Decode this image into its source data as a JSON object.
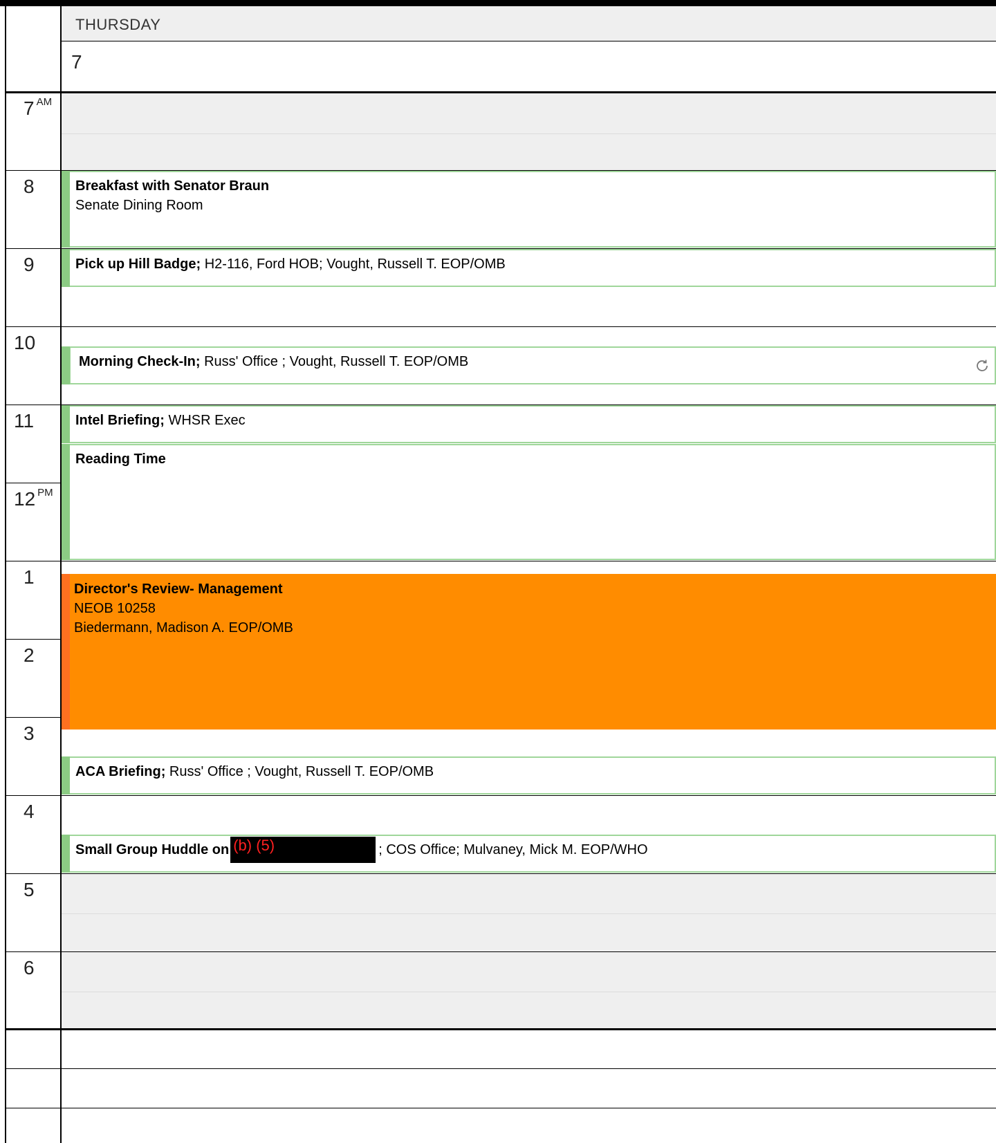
{
  "day": {
    "name": "THURSDAY",
    "number": "7"
  },
  "hours": [
    {
      "label": "7",
      "suffix": "AM"
    },
    {
      "label": "8",
      "suffix": ""
    },
    {
      "label": "9",
      "suffix": ""
    },
    {
      "label": "10",
      "suffix": ""
    },
    {
      "label": "11",
      "suffix": ""
    },
    {
      "label": "12",
      "suffix": "PM"
    },
    {
      "label": "1",
      "suffix": ""
    },
    {
      "label": "2",
      "suffix": ""
    },
    {
      "label": "3",
      "suffix": ""
    },
    {
      "label": "4",
      "suffix": ""
    },
    {
      "label": "5",
      "suffix": ""
    },
    {
      "label": "6",
      "suffix": ""
    }
  ],
  "events": {
    "breakfast": {
      "title": "Breakfast with Senator Braun",
      "location": "Senate Dining Room"
    },
    "badge": {
      "title": "Pick up Hill Badge;",
      "details": " H2-116, Ford HOB; Vought, Russell T. EOP/OMB"
    },
    "checkin": {
      "title": "Morning Check-In;",
      "details": " Russ' Office ; Vought, Russell T. EOP/OMB",
      "icon": "sync-icon"
    },
    "intel": {
      "title": "Intel Briefing;",
      "details": " WHSR Exec"
    },
    "reading": {
      "title": "Reading Time"
    },
    "review": {
      "title": "Director's Review- Management",
      "location": "NEOB 10258",
      "attendee": "Biedermann, Madison A. EOP/OMB",
      "color": "#ff8c00"
    },
    "aca": {
      "title": "ACA Briefing;",
      "details": " Russ' Office ; Vought, Russell T. EOP/OMB"
    },
    "huddle": {
      "title": "Small Group Huddle on",
      "redaction": "(b) (5)",
      "details": "; COS Office; Mulvaney, Mick M. EOP/WHO"
    }
  },
  "colors": {
    "event_border": "#9fd69a",
    "event_bar": "#8ccc84",
    "highlight": "#ff8c00",
    "off_hours": "#efefef"
  }
}
